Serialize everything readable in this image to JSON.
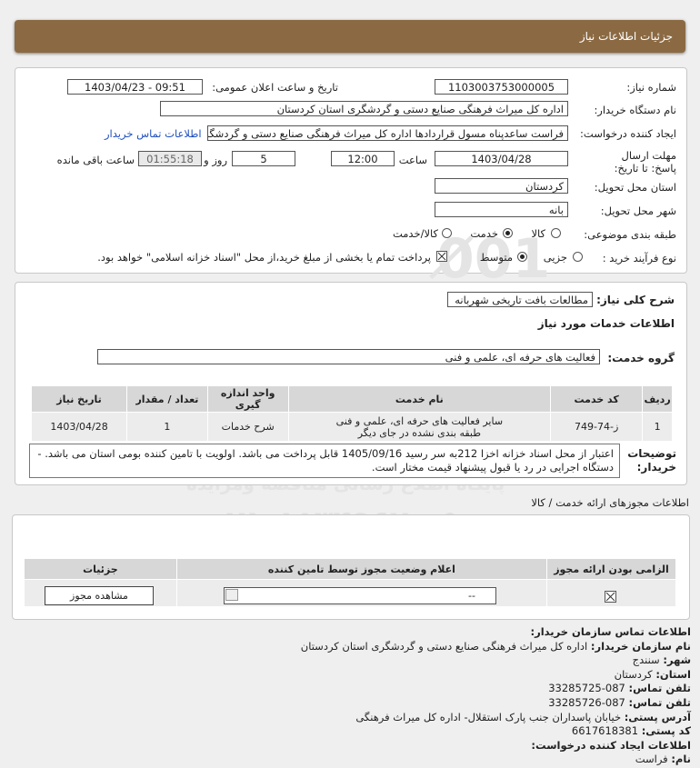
{
  "header": {
    "title": "جزئیات اطلاعات نیاز"
  },
  "form": {
    "need_number_label": "شماره نیاز:",
    "need_number": "1103003753000005",
    "announce_label": "تاریخ و ساعت اعلان عمومی:",
    "announce_value": "1403/04/23 - 09:51",
    "buyer_org_label": "نام دستگاه خریدار:",
    "buyer_org": "اداره کل میراث فرهنگی  صنایع دستی و گردشگری استان کردستان",
    "creator_label": "ایجاد کننده درخواست:",
    "creator": "فراست ساعدپناه مسول قراردادها اداره کل میراث فرهنگی  صنایع دستی و گردشگری استان کردستان",
    "contact_link": "اطلاعات تماس خریدار",
    "deadline_label": "مهلت ارسال پاسخ: تا تاریخ:",
    "deadline_date": "1403/04/28",
    "hour_label": "ساعت",
    "deadline_time": "12:00",
    "days_value": "5",
    "days_label": "روز و",
    "remaining_time": "01:55:18",
    "remaining_label": "ساعت باقی مانده",
    "province_label": "استان محل تحویل:",
    "province": "کردستان",
    "city_label": "شهر محل تحویل:",
    "city": "بانه",
    "category_label": "طبقه بندی موضوعی:",
    "category_options": [
      "کالا",
      "خدمت",
      "کالا/خدمت"
    ],
    "process_label": "نوع فرآیند خرید :",
    "process_options": [
      "جزیی",
      "متوسط"
    ],
    "treasury_note": "پرداخت تمام یا بخشی از مبلغ خرید،از محل \"اسناد خزانه اسلامی\" خواهد بود."
  },
  "need": {
    "description_label": "شرح کلی نیاز:",
    "description": "مطالعات بافت تاریخی شهربانه",
    "services_title": "اطلاعات خدمات مورد نیاز",
    "service_group_label": "گروه خدمت:",
    "service_group": "فعالیت های حرفه ای، علمی و فنی",
    "table_headers": [
      "ردیف",
      "کد خدمت",
      "نام خدمت",
      "واحد اندازه گیری",
      "تعداد / مقدار",
      "تاریخ نیاز"
    ],
    "rows": [
      {
        "row": "1",
        "code": "ز-74-749",
        "name": "سایر فعالیت های حرفه ای، علمی و فنی طبقه بندی نشده در جای دیگر",
        "unit": "شرح خدمات",
        "qty": "1",
        "date": "1403/04/28"
      }
    ],
    "buyer_notes_label": "توضیحات خریدار:",
    "buyer_notes": "اعتبار از محل اسناد خزانه اخزا 212به سر رسید 1405/09/16 قابل پرداخت می باشد. اولویت با تامین کننده بومی استان می باشد. - دستگاه اجرایی در رد یا قبول پیشنهاد قیمت مختار است."
  },
  "permits": {
    "section_title": "اطلاعات مجوزهای ارائه خدمت / کالا",
    "headers": [
      "الزامی بودن ارائه مجوز",
      "اعلام وضعیت مجوز توسط تامین کننده",
      "جزئیات"
    ],
    "status_value": "--",
    "view_button": "مشاهده مجوز"
  },
  "contact": {
    "title": "اطلاعات تماس سازمان خریدار:",
    "org_label": "نام سازمان خریدار:",
    "org": "اداره کل میراث فرهنگی صنایع دستی و گردشگری استان کردستان",
    "city_label": "شهر:",
    "city": "سنندج",
    "province_label": "استان:",
    "province": "کردستان",
    "phone_label": "تلفن تماس:",
    "phone": "087-33285725",
    "fax_label": "تلفن تماس:",
    "fax": "087-33285726",
    "address_label": "آدرس پستی:",
    "address": "خیابان پاسداران جنب پارک استقلال- اداره کل میراث فرهنگی",
    "postal_label": "کد پستی:",
    "postal": "6617618381",
    "creator_title": "اطلاعات ایجاد کننده درخواست:",
    "name_label": "نام:",
    "name": "فراست"
  },
  "watermark": {
    "brand": "ParsNamadData",
    "tagline": "پایگاه اطلاع رسانی مناقصه ومزایده",
    "phone": "۰۲۱-۸۸۳۴۹۶۷۰-۵"
  }
}
